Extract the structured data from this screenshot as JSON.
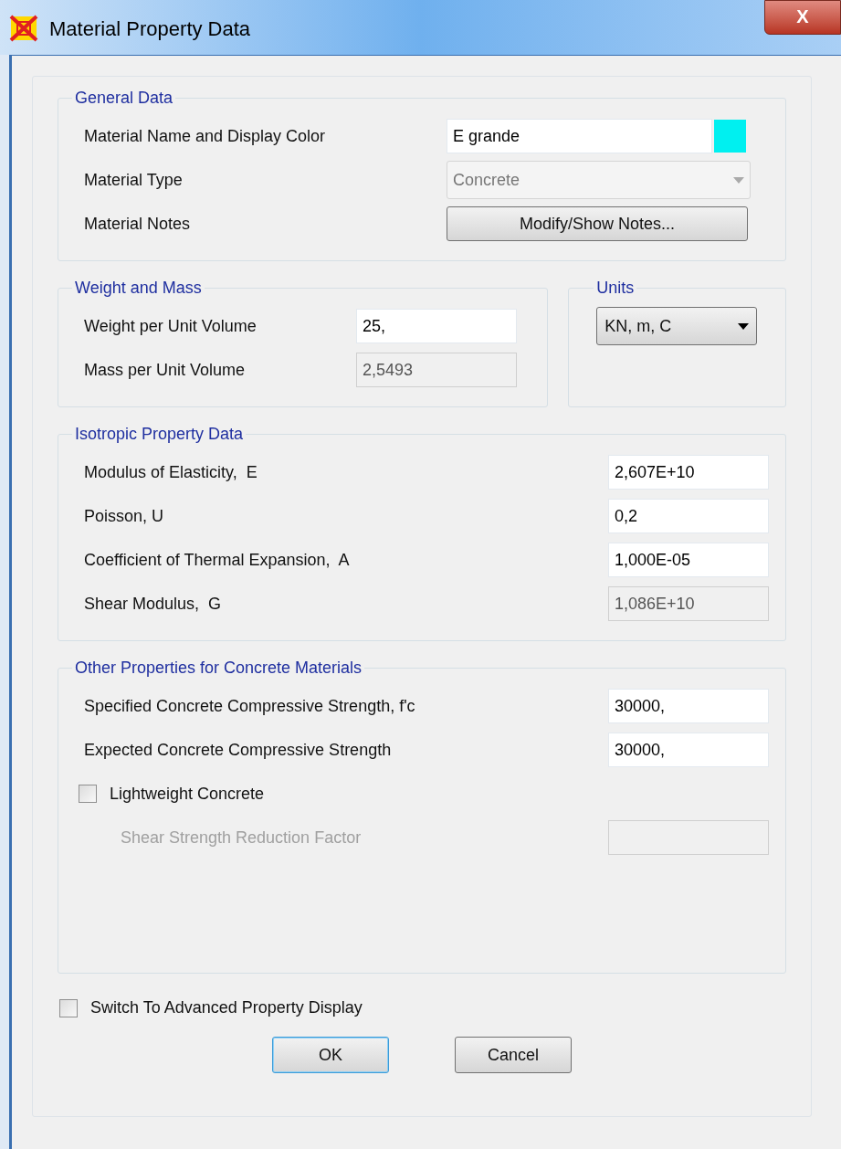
{
  "window": {
    "title": "Material Property Data",
    "close_label": "X"
  },
  "general": {
    "title": "General Data",
    "rows": [
      {
        "kind": "text",
        "label": "Material Name and Display Color",
        "value": "E grande",
        "color": "#00f0f0"
      },
      {
        "kind": "select",
        "label": "Material Type",
        "value": "Concrete",
        "disabled": true
      },
      {
        "kind": "button",
        "label": "Material Notes",
        "value": "Modify/Show Notes..."
      }
    ]
  },
  "weight": {
    "title": "Weight and Mass",
    "rows": [
      {
        "label": "Weight per Unit Volume",
        "value": "25,",
        "disabled": false
      },
      {
        "label": "Mass per Unit Volume",
        "value": "2,5493",
        "disabled": true
      }
    ]
  },
  "units": {
    "title": "Units",
    "value": "KN, m, C"
  },
  "isotropic": {
    "title": "Isotropic Property Data",
    "rows": [
      {
        "label": "Modulus of Elasticity,  E",
        "value": "2,607E+10",
        "disabled": false
      },
      {
        "label": "Poisson, U",
        "value": "0,2",
        "disabled": false
      },
      {
        "label": "Coefficient of Thermal Expansion,  A",
        "value": "1,000E-05",
        "disabled": false
      },
      {
        "label": "Shear Modulus,  G",
        "value": "1,086E+10",
        "disabled": true
      }
    ]
  },
  "other": {
    "title": "Other Properties for Concrete Materials",
    "rows": [
      {
        "label": "Specified Concrete Compressive Strength, f'c",
        "value": "30000,",
        "disabled": false
      },
      {
        "label": "Expected Concrete Compressive Strength",
        "value": "30000,",
        "disabled": false
      }
    ],
    "lightweight": {
      "label": "Lightweight Concrete",
      "checked": false
    },
    "reduction": {
      "label": "Shear Strength Reduction Factor",
      "disabled": true
    }
  },
  "advanced": {
    "label": "Switch To Advanced Property Display",
    "checked": false
  },
  "buttons": [
    {
      "label": "OK",
      "default": true
    },
    {
      "label": "Cancel",
      "default": false
    }
  ]
}
